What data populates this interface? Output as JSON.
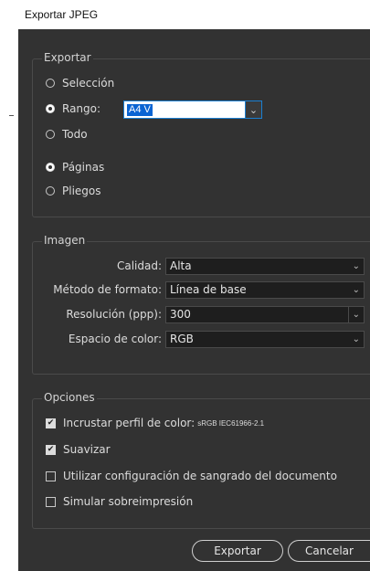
{
  "window": {
    "title": "Exportar JPEG"
  },
  "export_group": {
    "legend": "Exportar",
    "options": [
      {
        "label": "Selección",
        "selected": false
      },
      {
        "label": "Rango:",
        "selected": true
      },
      {
        "label": "Todo",
        "selected": false
      }
    ],
    "range_value": "A4 V",
    "page_options": [
      {
        "label": "Páginas",
        "selected": true
      },
      {
        "label": "Pliegos",
        "selected": false
      }
    ]
  },
  "image_group": {
    "legend": "Imagen",
    "fields": [
      {
        "label": "Calidad:",
        "value": "Alta"
      },
      {
        "label": "Método de formato:",
        "value": "Línea de base"
      },
      {
        "label": "Resolución (ppp):",
        "value": "300"
      },
      {
        "label": "Espacio de color:",
        "value": "RGB"
      }
    ]
  },
  "options_group": {
    "legend": "Opciones",
    "embed_profile_label": "Incrustar perfil de color:",
    "embed_profile_value": "sRGB IEC61966-2.1",
    "checkboxes": [
      {
        "label": "Incrustar perfil de color:",
        "checked": true
      },
      {
        "label": "Suavizar",
        "checked": true
      },
      {
        "label": "Utilizar configuración de sangrado del documento",
        "checked": false
      },
      {
        "label": "Simular sobreimpresión",
        "checked": false
      }
    ]
  },
  "buttons": {
    "export": "Exportar",
    "cancel": "Cancelar"
  }
}
